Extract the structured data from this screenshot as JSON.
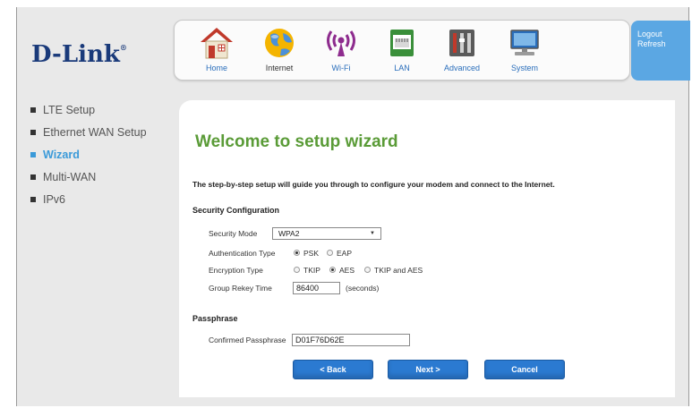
{
  "brand": {
    "logo": "D-Link",
    "trademark": "®"
  },
  "nav": [
    {
      "label": "Home",
      "icon": "home-icon"
    },
    {
      "label": "Internet",
      "icon": "globe-icon"
    },
    {
      "label": "Wi-Fi",
      "icon": "wifi-icon"
    },
    {
      "label": "LAN",
      "icon": "lan-port-icon"
    },
    {
      "label": "Advanced",
      "icon": "tools-icon"
    },
    {
      "label": "System",
      "icon": "monitor-icon"
    }
  ],
  "user": {
    "logout": "Logout",
    "refresh": "Refresh"
  },
  "sidebar": {
    "items": [
      {
        "label": "LTE Setup"
      },
      {
        "label": "Ethernet WAN Setup"
      },
      {
        "label": "Wizard"
      },
      {
        "label": "Multi-WAN"
      },
      {
        "label": "IPv6"
      }
    ],
    "active_index": 2
  },
  "page": {
    "title": "Welcome to setup wizard",
    "description": "The step-by-step setup will guide you through to configure your modem and connect to the Internet."
  },
  "security": {
    "heading": "Security Configuration",
    "mode_label": "Security Mode",
    "mode_value": "WPA2",
    "auth_label": "Authentication Type",
    "auth_options": [
      "PSK",
      "EAP"
    ],
    "auth_selected": "PSK",
    "enc_label": "Encryption Type",
    "enc_options": [
      "TKIP",
      "AES",
      "TKIP and AES"
    ],
    "enc_selected": "AES",
    "rekey_label": "Group Rekey Time",
    "rekey_value": "86400",
    "rekey_unit": "(seconds)"
  },
  "passphrase": {
    "heading": "Passphrase",
    "label": "Confirmed Passphrase",
    "value": "D01F76D62E"
  },
  "buttons": {
    "back": "< Back",
    "next": "Next >",
    "cancel": "Cancel"
  },
  "colors": {
    "accent_green": "#5a9b37",
    "link_blue": "#3a9ad9",
    "button_blue": "#2b7ad1",
    "user_panel": "#5ba7e3"
  }
}
